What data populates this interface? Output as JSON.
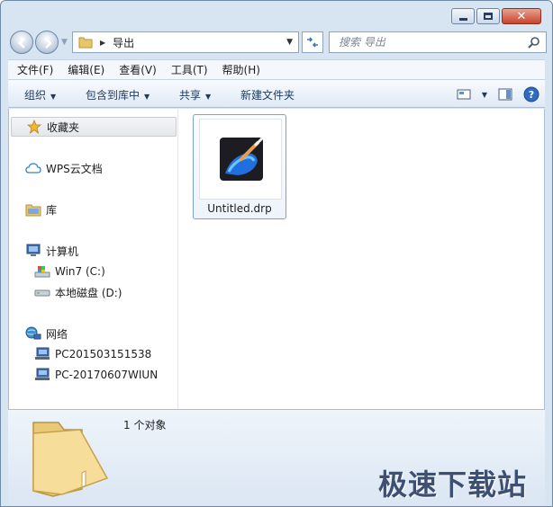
{
  "window": {
    "caption_buttons": {
      "close": "✕"
    }
  },
  "address_bar": {
    "path": "导出"
  },
  "search": {
    "placeholder": "搜索 导出"
  },
  "menu": [
    "文件(F)",
    "编辑(E)",
    "查看(V)",
    "工具(T)",
    "帮助(H)"
  ],
  "commands": {
    "organize": "组织",
    "include_in_library": "包含到库中",
    "share": "共享",
    "new_folder": "新建文件夹"
  },
  "nav_pane": {
    "favorites": "收藏夹",
    "wps_cloud": "WPS云文档",
    "libraries": "库",
    "computer": "计算机",
    "drive_c": "Win7 (C:)",
    "drive_d": "本地磁盘 (D:)",
    "network": "网络",
    "pc1": "PC201503151538",
    "pc2": "PC-20170607WIUN"
  },
  "files": [
    {
      "name": "Untitled.drp"
    }
  ],
  "details": {
    "count": "1 个对象"
  },
  "watermark": "极速下载站",
  "colors": {
    "accent": "#3b78c2",
    "frame": "#d7e4f2",
    "selection": "#7da2ce"
  }
}
